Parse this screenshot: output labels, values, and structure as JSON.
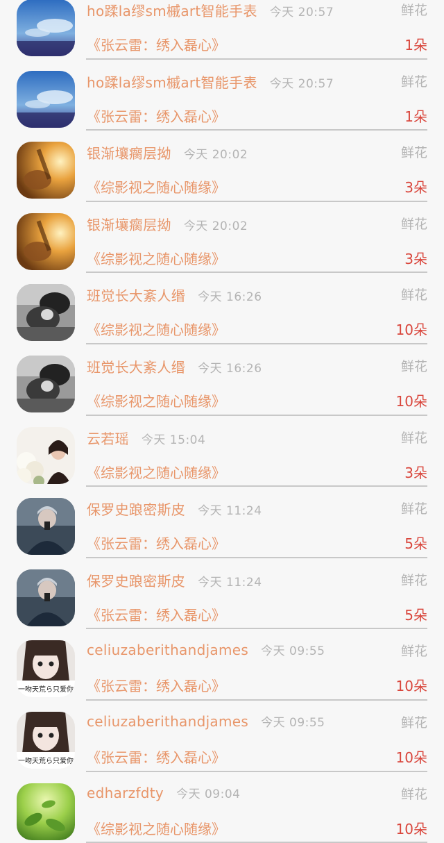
{
  "rows": [
    {
      "name": "ho蹂la缪sm槭art智能手表",
      "time": "今天 20:57",
      "gift": "鲜花",
      "book": "《张云雷：绣入磊心》",
      "count": "1朵",
      "avatar_icon": "sky-photo-avatar"
    },
    {
      "name": "ho蹂la缪sm槭art智能手表",
      "time": "今天 20:57",
      "gift": "鲜花",
      "book": "《张云雷：绣入磊心》",
      "count": "1朵",
      "avatar_icon": "sky-photo-avatar"
    },
    {
      "name": "银渐壤瘸层拗",
      "time": "今天 20:02",
      "gift": "鲜花",
      "book": "《综影视之随心随缘》",
      "count": "3朵",
      "avatar_icon": "guitar-sunset-avatar"
    },
    {
      "name": "银渐壤瘸层拗",
      "time": "今天 20:02",
      "gift": "鲜花",
      "book": "《综影视之随心随缘》",
      "count": "3朵",
      "avatar_icon": "guitar-sunset-avatar"
    },
    {
      "name": "班觉长大紊人缗",
      "time": "今天 16:26",
      "gift": "鲜花",
      "book": "《综影视之随心随缘》",
      "count": "10朵",
      "avatar_icon": "couple-bw-avatar"
    },
    {
      "name": "班觉长大紊人缗",
      "time": "今天 16:26",
      "gift": "鲜花",
      "book": "《综影视之随心随缘》",
      "count": "10朵",
      "avatar_icon": "couple-bw-avatar"
    },
    {
      "name": "云若瑶",
      "time": "今天 15:04",
      "gift": "鲜花",
      "book": "《综影视之随心随缘》",
      "count": "3朵",
      "avatar_icon": "flower-girl-avatar"
    },
    {
      "name": "保罗史踉密斯皮",
      "time": "今天 11:24",
      "gift": "鲜花",
      "book": "《张云雷：绣入磊心》",
      "count": "5朵",
      "avatar_icon": "selfie-boy-avatar"
    },
    {
      "name": "保罗史踉密斯皮",
      "time": "今天 11:24",
      "gift": "鲜花",
      "book": "《张云雷：绣入磊心》",
      "count": "5朵",
      "avatar_icon": "selfie-boy-avatar"
    },
    {
      "name": "celiuzaberithandjames",
      "time": "今天 09:55",
      "gift": "鲜花",
      "book": "《张云雷：绣入磊心》",
      "count": "10朵",
      "avatar_icon": "girl-caption-avatar",
      "avatar_text": "一吻天荒ら只爱你"
    },
    {
      "name": "celiuzaberithandjames",
      "time": "今天 09:55",
      "gift": "鲜花",
      "book": "《张云雷：绣入磊心》",
      "count": "10朵",
      "avatar_icon": "girl-caption-avatar",
      "avatar_text": "一吻天荒ら只爱你"
    },
    {
      "name": "edharzfdty",
      "time": "今天 09:04",
      "gift": "鲜花",
      "book": "《综影视之随心随缘》",
      "count": "10朵",
      "avatar_icon": "green-leaves-avatar"
    }
  ]
}
